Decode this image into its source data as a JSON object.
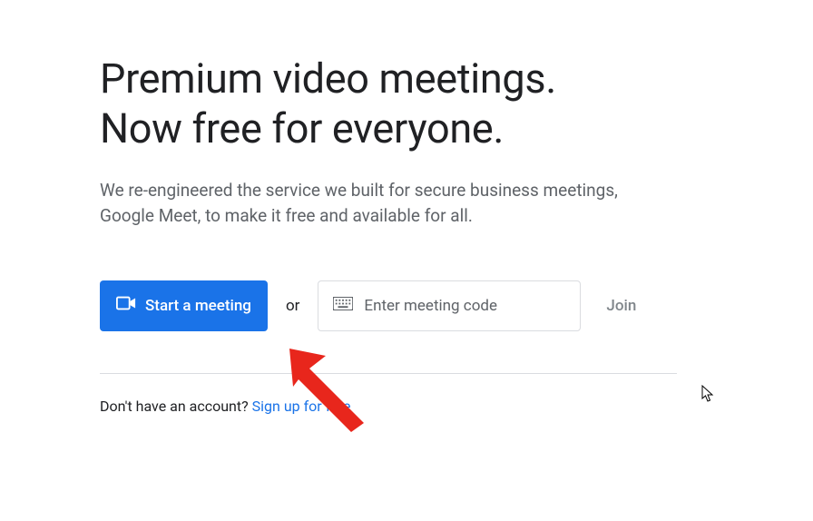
{
  "hero": {
    "headline_line1": "Premium video meetings.",
    "headline_line2": "Now free for everyone.",
    "subhead": "We re-engineered the service we built for secure business meetings, Google Meet, to make it free and available for all."
  },
  "actions": {
    "start_label": "Start a meeting",
    "or_label": "or",
    "code_placeholder": "Enter meeting code",
    "join_label": "Join"
  },
  "signup": {
    "prompt": "Don't have an account? ",
    "link_label": "Sign up for free"
  },
  "colors": {
    "primary": "#1a73e8",
    "text": "#202124",
    "muted": "#5f6368",
    "border": "#dadce0"
  }
}
